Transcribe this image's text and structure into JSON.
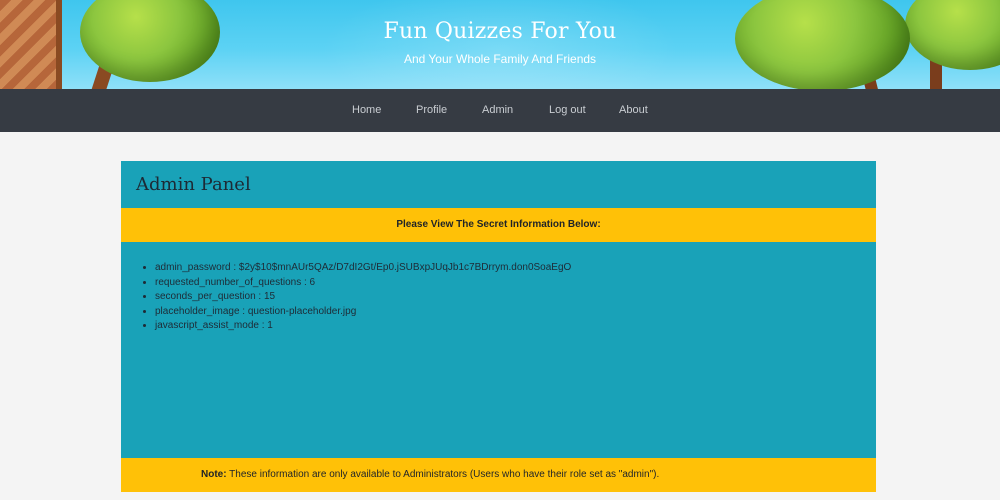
{
  "header": {
    "title": "Fun Quizzes For You",
    "subtitle": "And Your Whole Family And Friends"
  },
  "nav": {
    "items": [
      {
        "label": "Home"
      },
      {
        "label": "Profile"
      },
      {
        "label": "Admin"
      },
      {
        "label": "Log out"
      },
      {
        "label": "About"
      }
    ]
  },
  "panel": {
    "title": "Admin Panel",
    "banner_text": "Please View The Secret Information Below:",
    "info_items": [
      "admin_password : $2y$10$mnAUr5QAz/D7dI2Gt/Ep0.jSUBxpJUqJb1c7BDrrym.don0SoaEgO",
      "requested_number_of_questions : 6",
      "seconds_per_question : 15",
      "placeholder_image : question-placeholder.jpg",
      "javascript_assist_mode : 1"
    ],
    "note_label": "Note:",
    "note_text": " These information are only available to Administrators (Users who have their role set as \"admin\")."
  },
  "colors": {
    "banner_sky": "#5cd2f4",
    "navbar": "#363b43",
    "panel_teal": "#19a2b8",
    "panel_yellow": "#ffc107"
  }
}
